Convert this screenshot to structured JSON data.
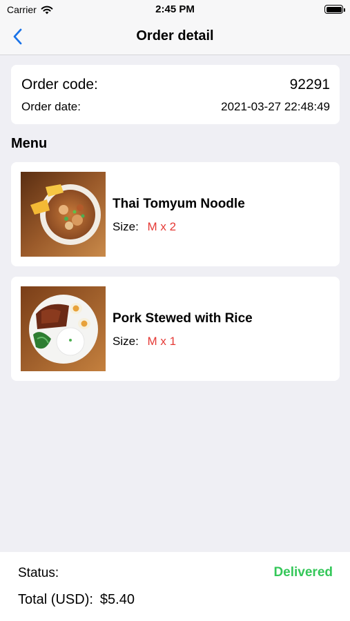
{
  "status_bar": {
    "carrier": "Carrier",
    "time": "2:45 PM",
    "wifi_icon": "wifi-icon",
    "battery_icon": "battery-icon"
  },
  "nav": {
    "title": "Order detail",
    "back_icon": "chevron-left-icon",
    "accent_color": "#1a73e8"
  },
  "order": {
    "code_label": "Order code:",
    "code_value": "92291",
    "date_label": "Order date:",
    "date_value": "2021-03-27 22:48:49"
  },
  "menu": {
    "title": "Menu",
    "items": [
      {
        "name": "Thai Tomyum Noodle",
        "size_label": "Size:",
        "size_value": "M x 2"
      },
      {
        "name": "Pork Stewed with Rice",
        "size_label": "Size:",
        "size_value": "M x 1"
      }
    ]
  },
  "summary": {
    "status_label": "Status:",
    "status_value": "Delivered",
    "status_color": "#34c759",
    "total_label": "Total (USD):",
    "total_value": "$5.40"
  }
}
